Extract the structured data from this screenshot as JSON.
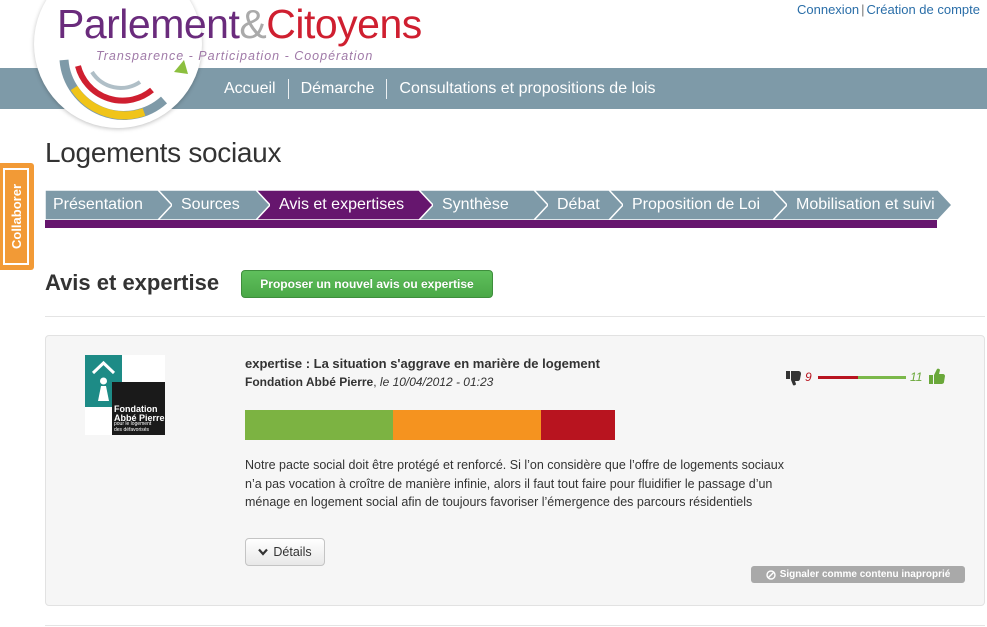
{
  "header": {
    "logo_part1": "Parlement",
    "logo_amp": "&",
    "logo_part2": "Citoyens",
    "tagline": "Transparence - Participation - Coopération",
    "top_links": {
      "login": "Connexion",
      "separator": "|",
      "signup": "Création de compte"
    },
    "nav": [
      "Accueil",
      "Démarche",
      "Consultations et propositions de lois"
    ]
  },
  "sidebar_tab": {
    "label": "Collaborer",
    "color": "#f29a36"
  },
  "page": {
    "title": "Logements sociaux"
  },
  "steps": {
    "items": [
      "Présentation",
      "Sources",
      "Avis et expertises",
      "Synthèse",
      "Débat",
      "Proposition de Loi",
      "Mobilisation et suivi"
    ],
    "active_index": 2,
    "inactive_color": "#7e9aa8",
    "active_color": "#66166e"
  },
  "section": {
    "title": "Avis et expertise",
    "propose_button": "Proposer un nouvel avis ou expertise"
  },
  "avis": {
    "org_logo_line1": "Fondation",
    "org_logo_line2": "Abbé Pierre",
    "org_logo_small1": "pour le logement",
    "org_logo_small2": "des défavorisés",
    "title": "expertise : La situation s'aggrave en marière de logement",
    "author": "Fondation Abbé Pierre",
    "date": "le 10/04/2012 - 01:23",
    "rating_segments": [
      {
        "color": "#7cb342",
        "share": 0.4
      },
      {
        "color": "#f5931f",
        "share": 0.4
      },
      {
        "color": "#b8141f",
        "share": 0.2
      }
    ],
    "body": "Notre pacte social doit être protégé et renforcé. Si l’on considère que l’offre de logements sociaux n’a pas vocation à croître de manière infinie, alors il faut tout faire pour fluidifier le passage d’un ménage en logement social afin de toujours favoriser l’émergence des parcours résidentiels",
    "details_button": "Détails",
    "votes_down": "9",
    "votes_up": "11",
    "report_button": "Signaler comme contenu inaproprié"
  }
}
